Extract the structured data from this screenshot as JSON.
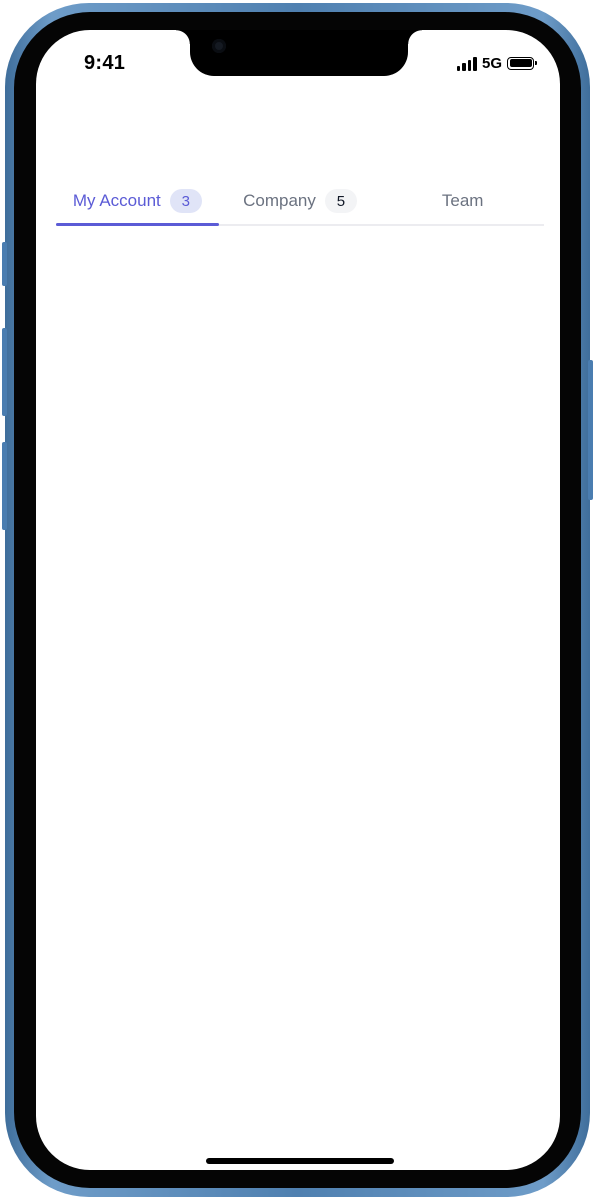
{
  "status_bar": {
    "time": "9:41",
    "network": "5G"
  },
  "tabs": [
    {
      "label": "My Account",
      "badge": "3",
      "active": true
    },
    {
      "label": "Company",
      "badge": "5",
      "active": false
    },
    {
      "label": "Team",
      "active": false
    }
  ],
  "colors": {
    "accent": "#5b5bd6",
    "inactive_text": "#6b7280",
    "frame": "#4f80b0"
  }
}
